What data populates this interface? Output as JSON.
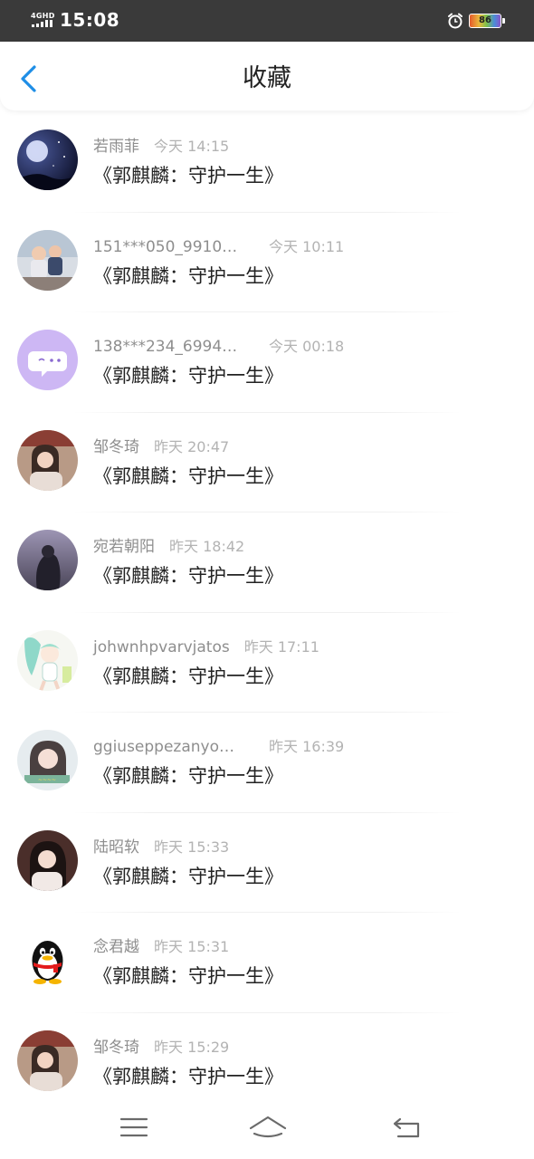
{
  "status_bar": {
    "network": "4GHD",
    "time": "15:08",
    "battery": "86"
  },
  "header": {
    "title": "收藏"
  },
  "items": [
    {
      "name": "若雨菲",
      "time": "今天 14:15",
      "message": "《郭麒麟：守护一生》",
      "avatar": "night-moon-avatar"
    },
    {
      "name": "151***050_9910…",
      "time": "今天 10:11",
      "message": "《郭麒麟：守护一生》",
      "avatar": "children-photo-avatar"
    },
    {
      "name": "138***234_6994…",
      "time": "今天 00:18",
      "message": "《郭麒麟：守护一生》",
      "avatar": "purple-chat-bubble-avatar"
    },
    {
      "name": "邹冬琦",
      "time": "昨天 20:47",
      "message": "《郭麒麟：守护一生》",
      "avatar": "woman-photo-avatar"
    },
    {
      "name": "宛若朝阳",
      "time": "昨天 18:42",
      "message": "《郭麒麟：守护一生》",
      "avatar": "girl-silhouette-avatar"
    },
    {
      "name": "johwnhpvarvjatos",
      "time": "昨天 17:11",
      "message": "《郭麒麟：守护一生》",
      "avatar": "anime-girl-avatar"
    },
    {
      "name": "ggiuseppezanyo…",
      "time": "昨天 16:39",
      "message": "《郭麒麟：守护一生》",
      "avatar": "woman-portrait-avatar"
    },
    {
      "name": "陆昭软",
      "time": "昨天 15:33",
      "message": "《郭麒麟：守护一生》",
      "avatar": "woman-dark-hair-avatar"
    },
    {
      "name": "念君越",
      "time": "昨天 15:31",
      "message": "《郭麒麟：守护一生》",
      "avatar": "qq-penguin-avatar"
    },
    {
      "name": "邹冬琦",
      "time": "昨天 15:29",
      "message": "《郭麒麟：守护一生》",
      "avatar": "woman-photo-avatar"
    }
  ],
  "nav": {
    "menu_icon": "menu-icon",
    "home_icon": "home-icon",
    "back_icon": "back-icon"
  },
  "colors": {
    "accent": "#1e8ee6",
    "status_bar_bg": "#3a3a3a",
    "name": "#8e8e8e",
    "time": "#b3b3b3",
    "message": "#222222"
  }
}
